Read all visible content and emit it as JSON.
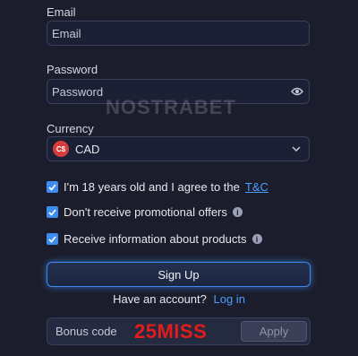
{
  "email": {
    "label": "Email",
    "placeholder": "Email",
    "value": ""
  },
  "password": {
    "label": "Password",
    "placeholder": "Password",
    "value": ""
  },
  "watermark": "NOSTRABET",
  "currency": {
    "label": "Currency",
    "icon_text": "C$",
    "selected": "CAD"
  },
  "checkboxes": [
    {
      "text": "I'm 18 years old and I agree to the",
      "link": "T&C",
      "checked": true
    },
    {
      "text": "Don't receive promotional offers",
      "info": "i",
      "checked": true
    },
    {
      "text": "Receive information about products",
      "info": "i",
      "checked": true
    }
  ],
  "signup_label": "Sign Up",
  "account": {
    "text": "Have an account?",
    "link": "Log in"
  },
  "bonus": {
    "label": "Bonus code",
    "code": "25MISS",
    "apply": "Apply"
  },
  "colors": {
    "accent": "#3d8df0",
    "link": "#4ba0ff",
    "bonus_code": "#e31b1b",
    "background": "#1b1d2c"
  }
}
